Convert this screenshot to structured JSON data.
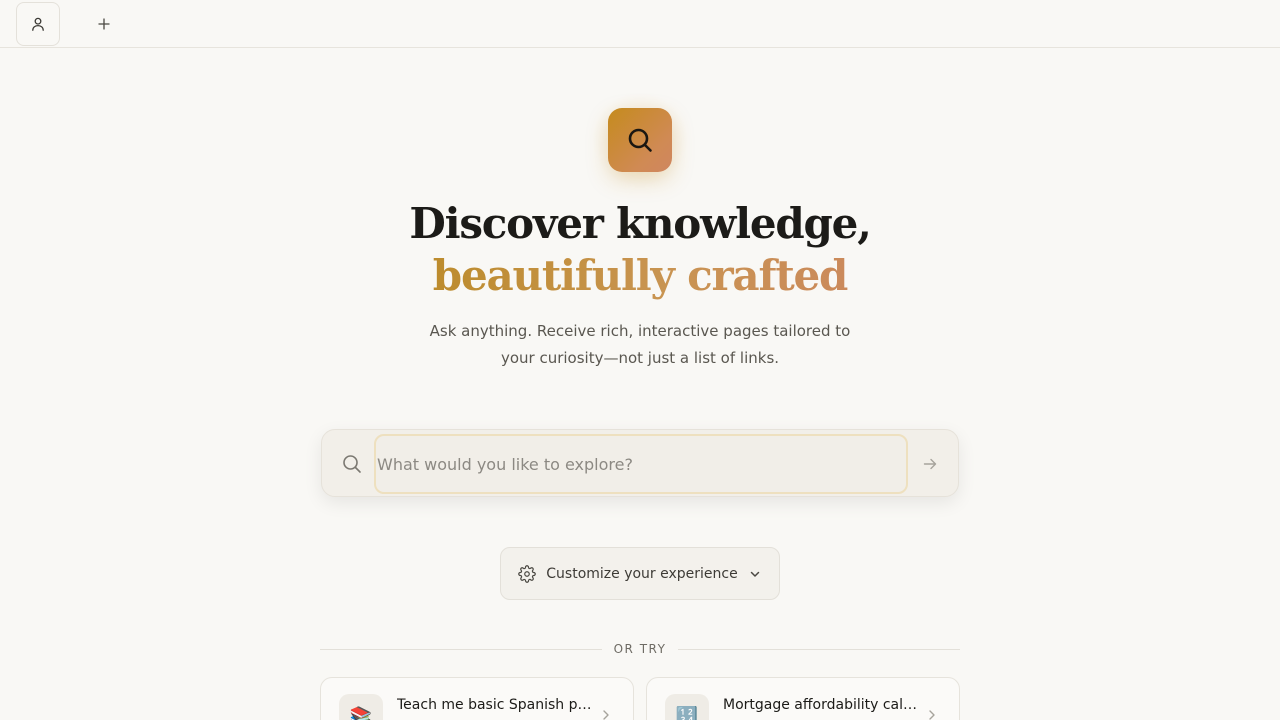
{
  "header": {
    "profile_icon": "user-icon",
    "new_icon": "plus-icon"
  },
  "hero": {
    "logo_icon": "search-icon",
    "headline_line1": "Discover knowledge,",
    "headline_line2": "beautifully crafted",
    "subtitle": "Ask anything. Receive rich, interactive pages tailored to your curiosity—not just a list of links.",
    "colors": {
      "accent_gold": "#c58b1d",
      "accent_copper": "#cc8560"
    }
  },
  "search": {
    "placeholder": "What would you like to explore?",
    "value": "",
    "submit_icon": "arrow-right-icon"
  },
  "customize": {
    "label": "Customize your experience",
    "icon": "gear-icon",
    "chevron": "chevron-down-icon"
  },
  "suggestions": {
    "divider_label": "OR TRY",
    "items": [
      {
        "emoji": "📚",
        "title": "Teach me basic Spanish ph..."
      },
      {
        "emoji": "🔢",
        "title": "Mortgage affordability calc..."
      }
    ]
  }
}
